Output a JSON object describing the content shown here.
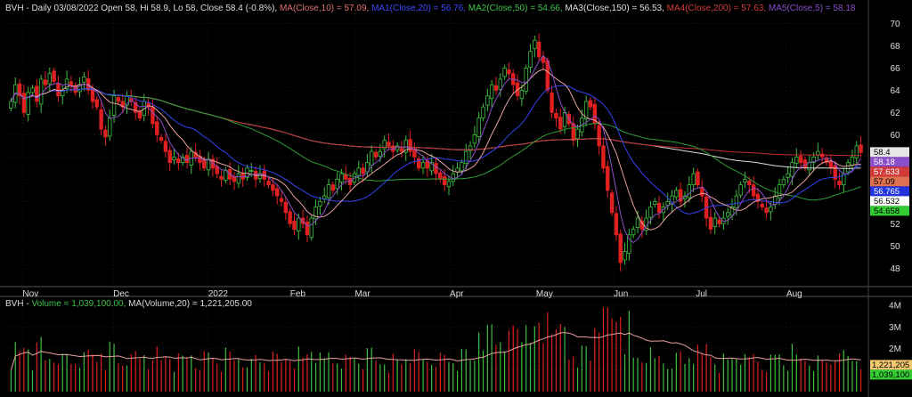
{
  "header": {
    "symbol": "BVH",
    "ohlc": "BVH - Daily 03/08/2022 Open 58, Hi 58.9, Lo 58, Close 58.4 (-0.8%)",
    "ma_items": [
      {
        "text": "MA(Close,10) = 57.09,",
        "color": "#e07070"
      },
      {
        "text": "MA1(Close,20) = 56.76,",
        "color": "#3b4bff"
      },
      {
        "text": "MA2(Close,50) = 54.66,",
        "color": "#3fc24a"
      },
      {
        "text": "MA3(Close,150) = 56.53,",
        "color": "#dddddd"
      },
      {
        "text": "MA4(Close,200) = 57.63,",
        "color": "#d23a3a"
      },
      {
        "text": "MA5(Close,5) = 58.18",
        "color": "#8a4fc8"
      }
    ],
    "volume_label_prefix": "BVH - ",
    "volume_label_value": "Volume = 1,039,100.00,",
    "volume_label_ma": "MA(Volume,20) = 1,221,205.00"
  },
  "colors": {
    "up": "#3fbf3f",
    "down": "#e02020",
    "ma10": "#e8a0a0",
    "ma20": "#3344ee",
    "ma50": "#2f9e3a",
    "ma150": "#dddddd",
    "ma200": "#c23030",
    "ma5": "#8a4fc8",
    "grid": "#333333",
    "axis_text": "#dddddd"
  },
  "chart_data": [
    {
      "type": "candlestick",
      "title": "BVH - Daily 03/08/2022",
      "x_ticks": [
        "Nov",
        "Dec",
        "2022",
        "Feb",
        "Mar",
        "Apr",
        "May",
        "Jun",
        "Jul",
        "Aug"
      ],
      "y_ticks": [
        48,
        50,
        52,
        54,
        56,
        58,
        60,
        62,
        64,
        66,
        68,
        70
      ],
      "ylim": [
        46.5,
        71
      ],
      "grid": true,
      "last_values": [
        {
          "label": "58.4",
          "value": 58.4,
          "bg": "#e6e6e6",
          "fg": "#000000"
        },
        {
          "label": "58.18",
          "value": 58.18,
          "bg": "#8a4fc8",
          "fg": "#ffffff"
        },
        {
          "label": "57.633",
          "value": 57.63,
          "bg": "#d23a3a",
          "fg": "#ffffff"
        },
        {
          "label": "57.09",
          "value": 57.09,
          "bg": "#e07050",
          "fg": "#000000"
        },
        {
          "label": "56.765",
          "value": 56.76,
          "bg": "#2233dd",
          "fg": "#ffffff"
        },
        {
          "label": "56.532",
          "value": 56.53,
          "bg": "#ffffff",
          "fg": "#000000"
        },
        {
          "label": "54.658",
          "value": 54.66,
          "bg": "#33cc33",
          "fg": "#000000"
        }
      ],
      "closes": [
        63.0,
        64.5,
        63.5,
        62.0,
        63.8,
        64.2,
        63.0,
        65.0,
        64.5,
        65.5,
        64.8,
        63.5,
        64.0,
        65.0,
        64.5,
        63.8,
        64.5,
        65.2,
        64.0,
        63.0,
        62.5,
        60.5,
        59.8,
        61.5,
        63.5,
        63.0,
        62.5,
        63.5,
        63.0,
        62.0,
        61.5,
        63.0,
        62.5,
        61.0,
        60.0,
        59.5,
        58.5,
        57.5,
        58.0,
        57.5,
        58.0,
        57.5,
        58.5,
        58.0,
        57.5,
        57.0,
        57.8,
        57.0,
        56.5,
        56.0,
        56.8,
        56.0,
        55.8,
        56.5,
        56.0,
        57.0,
        56.8,
        56.0,
        56.5,
        56.0,
        55.5,
        55.0,
        54.5,
        54.0,
        53.0,
        52.0,
        51.5,
        52.5,
        52.0,
        51.0,
        52.5,
        53.5,
        54.0,
        54.5,
        55.5,
        55.0,
        56.0,
        56.5,
        56.0,
        55.5,
        56.5,
        57.0,
        56.5,
        57.5,
        58.5,
        58.0,
        58.5,
        59.5,
        59.0,
        58.5,
        59.0,
        58.5,
        59.5,
        58.5,
        58.0,
        57.0,
        57.5,
        57.0,
        57.5,
        56.5,
        56.0,
        55.5,
        55.8,
        56.5,
        57.0,
        57.5,
        58.5,
        59.0,
        60.0,
        61.5,
        62.5,
        63.5,
        64.5,
        64.0,
        65.0,
        66.0,
        65.5,
        64.5,
        63.5,
        64.0,
        66.0,
        67.5,
        68.5,
        67.0,
        66.5,
        64.0,
        62.0,
        61.5,
        60.5,
        62.0,
        61.0,
        59.5,
        60.5,
        61.5,
        63.0,
        62.5,
        61.0,
        59.0,
        57.0,
        55.0,
        53.0,
        51.0,
        48.5,
        49.5,
        51.0,
        51.5,
        52.5,
        51.5,
        52.5,
        53.5,
        54.0,
        53.0,
        53.5,
        54.0,
        54.5,
        55.0,
        54.0,
        54.5,
        55.5,
        56.5,
        55.5,
        54.5,
        52.5,
        51.5,
        52.5,
        52.0,
        52.5,
        53.0,
        53.5,
        54.5,
        55.5,
        56.0,
        55.5,
        54.5,
        54.0,
        53.5,
        53.0,
        53.5,
        54.5,
        55.5,
        56.0,
        56.5,
        57.5,
        58.0,
        57.5,
        57.0,
        57.5,
        58.0,
        58.5,
        58.0,
        57.5,
        57.0,
        56.0,
        55.5,
        56.5,
        57.5,
        58.0,
        59.0,
        58.4
      ],
      "series": [
        {
          "name": "MA(Close,10)",
          "last": 57.09
        },
        {
          "name": "MA1(Close,20)",
          "last": 56.76
        },
        {
          "name": "MA2(Close,50)",
          "last": 54.66
        },
        {
          "name": "MA3(Close,150)",
          "last": 56.53
        },
        {
          "name": "MA4(Close,200)",
          "last": 57.63
        },
        {
          "name": "MA5(Close,5)",
          "last": 58.18
        }
      ]
    },
    {
      "type": "bar",
      "title": "BVH - Volume = 1,039,100.00, MA(Volume,20) = 1,221,205.00",
      "y_ticks": [
        "1M",
        "2M",
        "3M",
        "4M"
      ],
      "y_tick_values": [
        1000000,
        2000000,
        3000000,
        4000000
      ],
      "ylim": [
        0,
        4000000
      ],
      "last_values": [
        {
          "label": "1,221,205",
          "value": 1221205,
          "bg": "#f4c870",
          "fg": "#000000"
        },
        {
          "label": "1,039,100",
          "value": 1039100,
          "bg": "#33cc33",
          "fg": "#000000"
        }
      ],
      "volume_ma_last": 1221205,
      "volume_last": 1039100
    }
  ]
}
